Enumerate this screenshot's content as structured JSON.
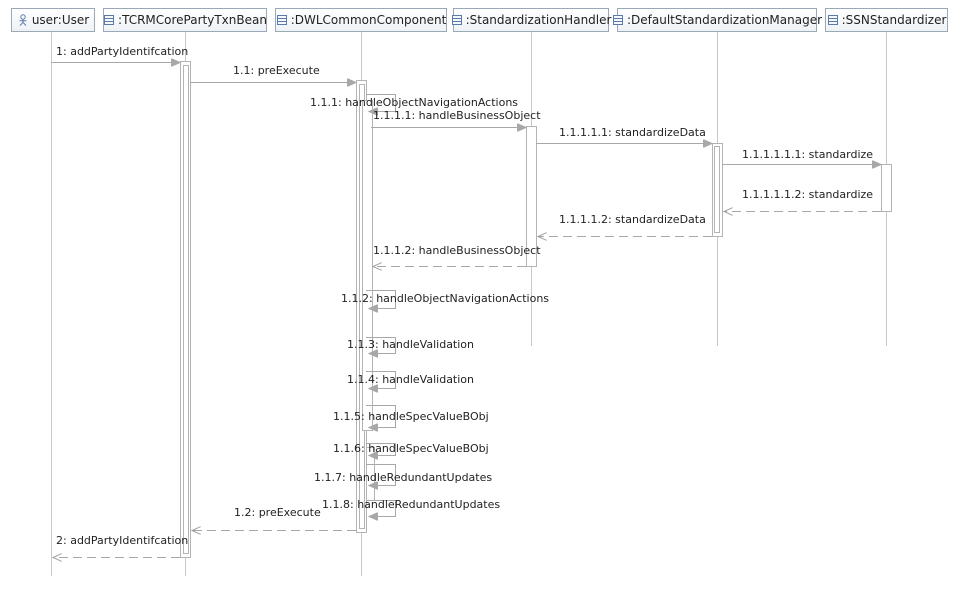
{
  "lifelines": [
    {
      "id": "user",
      "name": "user:User",
      "icon": "actor-icon"
    },
    {
      "id": "txn",
      "name": ":TCRMCorePartyTxnBean",
      "icon": "class-icon"
    },
    {
      "id": "dwl",
      "name": ":DWLCommonComponent",
      "icon": "class-icon"
    },
    {
      "id": "std",
      "name": ":StandardizationHandler",
      "icon": "class-icon"
    },
    {
      "id": "mgr",
      "name": ":DefaultStandardizationManager",
      "icon": "class-icon"
    },
    {
      "id": "ssn",
      "name": ":SSNStandardizer",
      "icon": "class-icon"
    }
  ],
  "messages": [
    {
      "label": "1: addPartyIdentifcation"
    },
    {
      "label": "1.1: preExecute"
    },
    {
      "label": "1.1.1: handleObjectNavigationActions"
    },
    {
      "label": "1.1.1.1: handleBusinessObject"
    },
    {
      "label": "1.1.1.1.1: standardizeData"
    },
    {
      "label": "1.1.1.1.1.1: standardize"
    },
    {
      "label": "1.1.1.1.1.2: standardize"
    },
    {
      "label": "1.1.1.1.2: standardizeData"
    },
    {
      "label": "1.1.1.2: handleBusinessObject"
    },
    {
      "label": "1.1.2: handleObjectNavigationActions"
    },
    {
      "label": "1.1.3: handleValidation"
    },
    {
      "label": "1.1.4: handleValidation"
    },
    {
      "label": "1.1.5: handleSpecValueBObj"
    },
    {
      "label": "1.1.6: handleSpecValueBObj"
    },
    {
      "label": "1.1.7: handleRedundantUpdates"
    },
    {
      "label": "1.1.8: handleRedundantUpdates"
    },
    {
      "label": "1.2: preExecute"
    },
    {
      "label": "2: addPartyIdentifcation"
    }
  ],
  "colors": {
    "line": "#a8a8a8",
    "box_border": "#9aa8b8",
    "icon": "#5b7aa8"
  }
}
